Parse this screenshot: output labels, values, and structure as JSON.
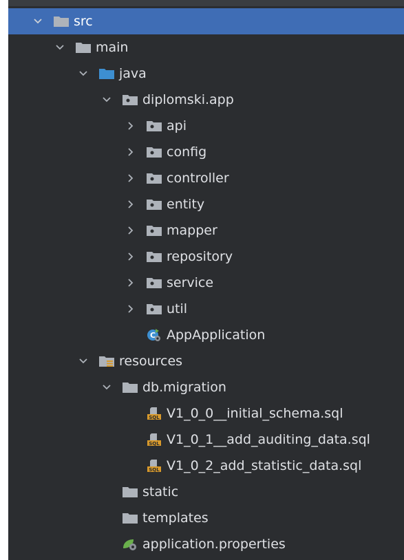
{
  "tree": {
    "src": "src",
    "main": "main",
    "java": "java",
    "package": "diplomski.app",
    "packages": [
      "api",
      "config",
      "controller",
      "entity",
      "mapper",
      "repository",
      "service",
      "util"
    ],
    "app_class": "AppApplication",
    "resources": "resources",
    "db_migration": "db.migration",
    "migrations": [
      "V1_0_0__initial_schema.sql",
      "V1_0_1__add_auditing_data.sql",
      "V1_0_2_add_statistic_data.sql"
    ],
    "static": "static",
    "templates": "templates",
    "properties": "application.properties"
  },
  "colors": {
    "background": "#2b2d30",
    "selection": "#3f6db5",
    "text": "#dfe1e5",
    "folder": "#aeb3ba",
    "source_folder": "#3d8fd1",
    "sql_badge": "#d99a2b"
  },
  "icons": {
    "folder": "folder-icon",
    "package": "package-icon",
    "source_folder": "source-folder-icon",
    "resources_folder": "resources-folder-icon",
    "spring_class": "spring-boot-class-icon",
    "sql_file": "sql-file-icon",
    "properties": "spring-properties-icon",
    "chevron_down": "chevron-down-icon",
    "chevron_right": "chevron-right-icon"
  }
}
